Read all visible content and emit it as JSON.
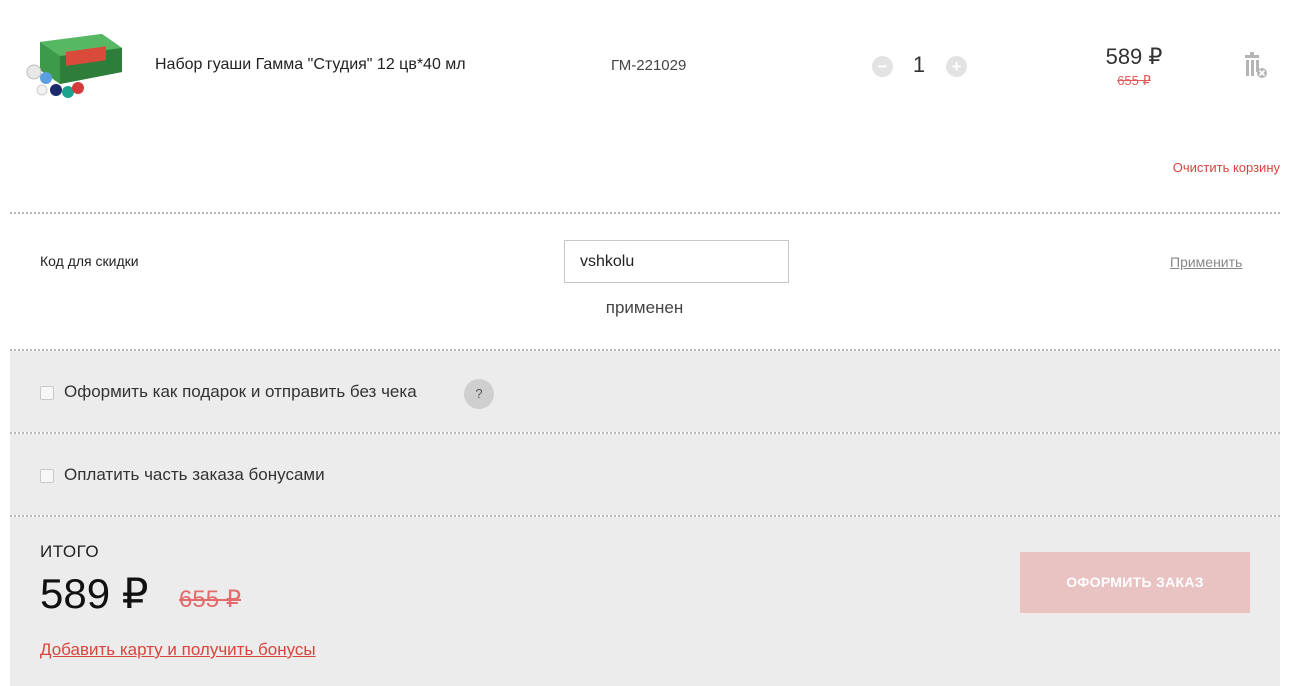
{
  "cart": {
    "item": {
      "name": "Набор гуаши Гамма \"Студия\" 12 цв*40 мл",
      "sku": "ГМ-221029",
      "quantity": "1",
      "qty_minus": "−",
      "qty_plus": "+",
      "price": "589 ₽",
      "old_price": "655 ₽",
      "delete_icon": "trash-icon"
    },
    "clear_label": "Очистить корзину"
  },
  "discount": {
    "label": "Код для скидки",
    "code_value": "vshkolu",
    "status": "применен",
    "apply_label": "Применить"
  },
  "options": {
    "gift_label": "Оформить как подарок и отправить без чека",
    "gift_help": "?",
    "bonus_pay_label": "Оплатить часть заказа бонусами"
  },
  "summary": {
    "total_label": "ИТОГО",
    "total_price": "589 ₽",
    "total_old_price": "655 ₽",
    "add_card_link": "Добавить карту и получить бонусы",
    "checkout_button": "ОФОРМИТЬ ЗАКАЗ"
  },
  "colors": {
    "accent": "#d6453d",
    "button_disabled": "#e9c2c2",
    "panel_bg": "#ececec"
  }
}
